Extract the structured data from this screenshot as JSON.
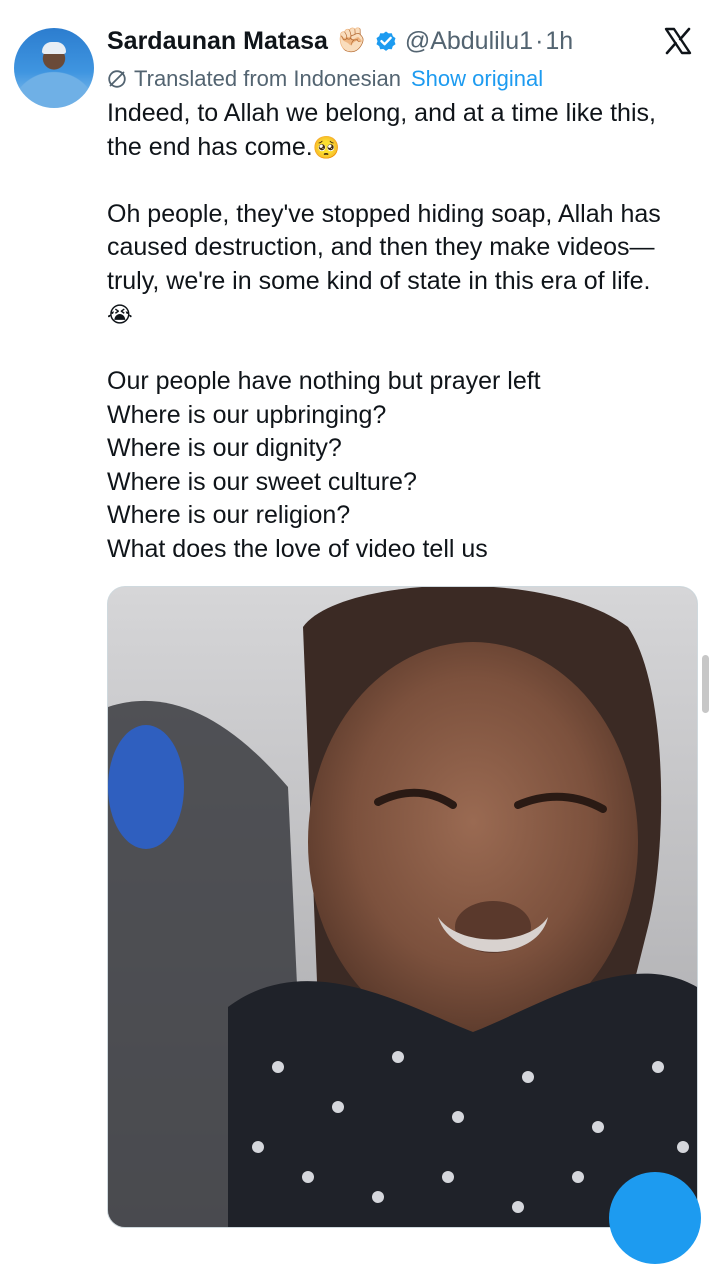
{
  "user": {
    "display_name": "Sardaunan Matasa",
    "name_emoji": "✊🏻",
    "handle": "@Abdulilu1",
    "separator": "·",
    "time": "1h"
  },
  "translation": {
    "label": "Translated from Indonesian",
    "show_original": "Show original"
  },
  "tweet": {
    "paragraph1": [
      "Indeed, to Allah we belong, and at a time like this,",
      "the end has come."
    ],
    "paragraph1_emoji": "🥺",
    "paragraph2": [
      "Oh people, they've stopped hiding soap, Allah has",
      "caused destruction, and then they make videos—",
      "truly, we're in some kind of state in this era of life."
    ],
    "paragraph2_emoji": "😭",
    "paragraph3": [
      "Our people have nothing but prayer left",
      "Where is our upbringing?",
      "Where is our dignity?",
      "Where is our sweet culture?",
      "Where is our religion?",
      "What does the love of video tell us"
    ]
  },
  "icons": {
    "verified": "verified-badge-icon",
    "translate": "globe-icon",
    "brand": "x-logo-icon"
  },
  "colors": {
    "text": "#0f1419",
    "secondary": "#536471",
    "link": "#1d9bf0",
    "verified": "#1d9bf0"
  }
}
